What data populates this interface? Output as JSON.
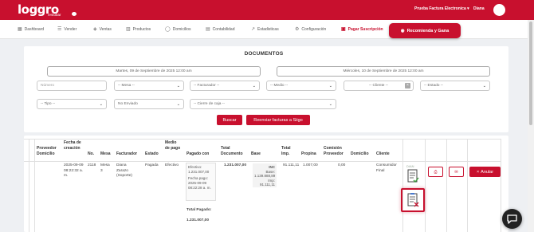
{
  "app": {
    "logo": "loggro",
    "logo_sub": "restobar",
    "company": "Prueba Factura Electronica ▾",
    "user": "Diana"
  },
  "nav": {
    "items": [
      {
        "label": "Dashboard",
        "icon": "dashboard-icon"
      },
      {
        "label": "Vender",
        "icon": "cart-icon"
      },
      {
        "label": "Ventas",
        "icon": "tag-icon"
      },
      {
        "label": "Productos",
        "icon": "basket-icon"
      },
      {
        "label": "Domicilios",
        "icon": "bike-icon"
      },
      {
        "label": "Contabilidad",
        "icon": "building-icon"
      },
      {
        "label": "Estadisticas",
        "icon": "chart-icon"
      },
      {
        "label": "Configuración",
        "icon": "gear-icon"
      }
    ],
    "pay_label": "Pagar Suscripción",
    "recommend_label": "Recomienda y Gana"
  },
  "filters": {
    "title": "DOCUMENTOS",
    "date_from": "Martes, 09 de Septiembre de 2025 12:00 am",
    "date_to": "Miércoles, 10 de Septiembre de 2025 12:00 am",
    "numero_placeholder": "Número",
    "mesa": "-- Mesa --",
    "facturador": "-- Facturador --",
    "medio": "-- Medio --",
    "cliente": "-- Cliente --",
    "estado": "-- Estado --",
    "tipo": "-- Tipo --",
    "envio": "No Enviado",
    "cierre": "-- Cierre de caja --",
    "search_label": "Buscar",
    "resend_label": "Reenviar facturas a Siigo"
  },
  "table": {
    "headers": {
      "proveedor": "Proveedor Domicilio",
      "fecha": "Fecha de creación",
      "no": "No.",
      "mesa": "Mesa",
      "facturador": "Facturador",
      "estado": "Estado",
      "medio": "Medio de pago",
      "pagado": "Pagado con",
      "total_doc": "Total Documento",
      "base": "Base",
      "total_imp": "Total Imp.",
      "propina": "Propina",
      "comision": "Comisión Proveedor",
      "domicilio": "Domicilio",
      "cliente": "Cliente"
    },
    "row": {
      "fecha": "2025-09-09 08:22:32 a. m.",
      "no": "2118",
      "mesa": "Mesa 3",
      "facturador": "Diana Zarazo (Soporte)",
      "estado": "Pagada",
      "medio": "Efectivo",
      "pagado_box": {
        "metodo": "Efectivo:",
        "monto": "1.231.007,00",
        "fecha_label": "Fecha pago:",
        "fecha": "2025-09-09 08:22:28 a. m."
      },
      "total_pagado_label": "Total Pagado:",
      "total_pagado": "1.231.007,00",
      "total_doc": "1.231.007,00",
      "base_box": {
        "tag": "INC",
        "base": "Base: 1.139.888,89",
        "imp": "Imp: 91.111,11"
      },
      "total_imp": "91.111,11",
      "propina": "1.007,00",
      "comision": "0,00",
      "domicilio": "",
      "cliente": "Consumidor Final",
      "doc_label": "DIAN",
      "anular_label": "Anular"
    }
  },
  "colors": {
    "brand_red": "#c8102e",
    "background": "#eef0f3"
  }
}
